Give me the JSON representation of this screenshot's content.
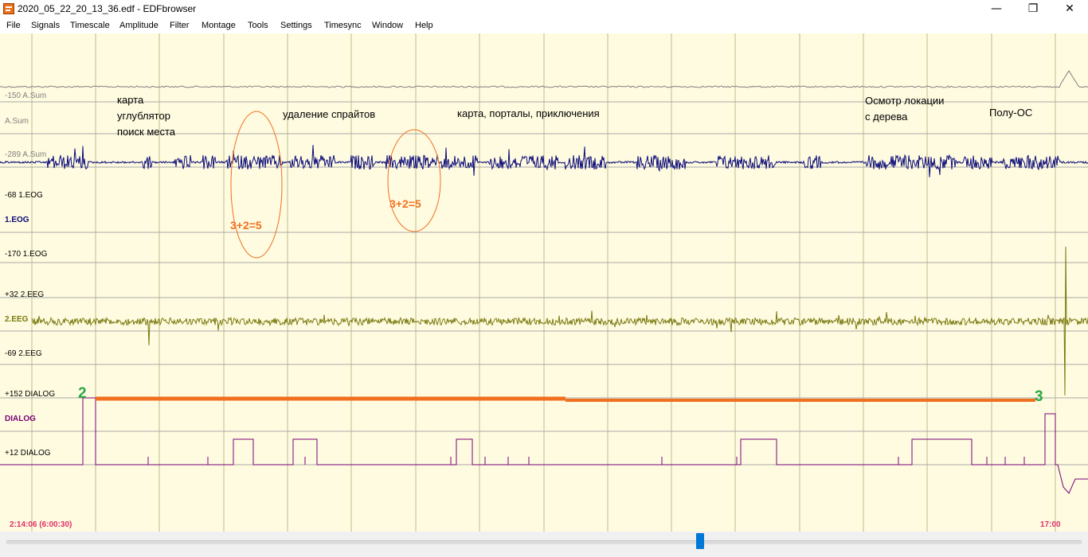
{
  "window": {
    "title": "2020_05_22_20_13_36.edf - EDFbrowser",
    "minimize": "—",
    "maximize": "❐",
    "close": "✕"
  },
  "menu": [
    "File",
    "Signals",
    "Timescale",
    "Amplitude",
    "Filter",
    "Montage",
    "Tools",
    "Settings",
    "Timesync",
    "Window",
    "Help"
  ],
  "signals": {
    "asum": {
      "top": "-150 A.Sum",
      "name": "A.Sum",
      "bottom": "-289 A.Sum",
      "color": "#808080"
    },
    "eog": {
      "top": "-68 1.EOG",
      "name": "1.EOG",
      "bottom": "-170 1.EOG",
      "color": "#0a0a78"
    },
    "eeg": {
      "top": "+32 2.EEG",
      "name": "2.EEG",
      "bottom": "-69 2.EEG",
      "color": "#7a7a10"
    },
    "dialog": {
      "top": "+152 DIALOG",
      "name": "DIALOG",
      "bottom": "+12 DIALOG",
      "color": "#780078"
    }
  },
  "annotations": {
    "a1": [
      "карта",
      "углублятор",
      "поиск места"
    ],
    "a2": "удаление спрайтов",
    "a3": "карта,  порталы,  приключения",
    "a4": [
      "Осмотр локации",
      "с дерева"
    ],
    "a5": "Полу-ОС",
    "sum1": "3+2=5",
    "sum2": "3+2=5",
    "marker_start": "2",
    "marker_end": "3"
  },
  "time": {
    "left": "2:14:06 (6:00:30)",
    "right": "17:00"
  },
  "scrollbar": {
    "position": 0.65
  }
}
